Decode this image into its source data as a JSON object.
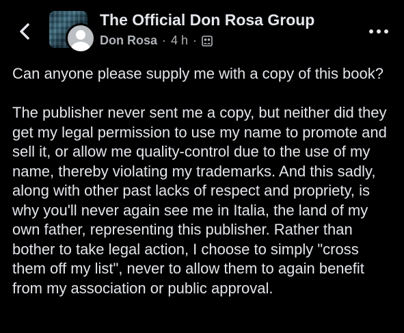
{
  "header": {
    "group_name": "The Official Don Rosa Group",
    "author": "Don Rosa",
    "separator": "·",
    "time": "4 h",
    "icons": {
      "back": "chevron-left-icon",
      "privacy": "group-members-icon",
      "more": "more-horizontal-icon"
    }
  },
  "post": {
    "paragraph_1": "Can anyone please supply me with a copy of this book?",
    "paragraph_2": "The publisher never sent me a copy, but neither did they get my legal permission to use my name to promote and sell it, or allow me quality-control due to the use of my name, thereby violating my trademarks. And this sadly, along with other past lacks of respect and propriety, is why you'll never again see me in Italia, the land of my own father, representing this publisher. Rather than bother to take legal action, I choose to simply \"cross them off my list\", never to allow them to again benefit from my association or public approval."
  },
  "colors": {
    "background": "#000000",
    "primary_text": "#e4e6eb",
    "secondary_text": "#b0b3b8"
  }
}
